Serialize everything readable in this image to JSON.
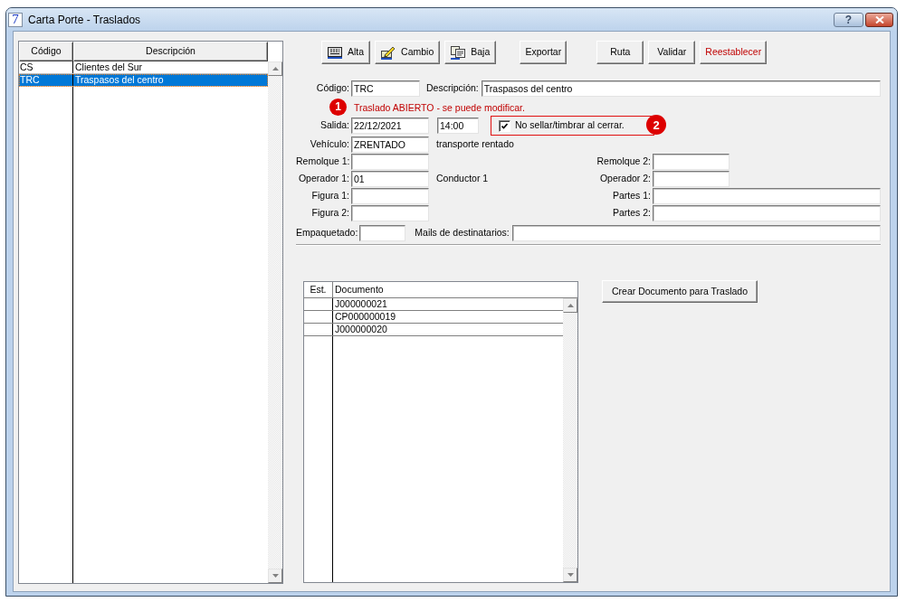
{
  "window": {
    "app_icon": "7",
    "title": "Carta Porte - Traslados",
    "help_button": "?"
  },
  "list": {
    "columns": [
      "Código",
      "Descripción"
    ],
    "rows": [
      {
        "cells": [
          "CS",
          "Clientes del Sur"
        ],
        "selected": false
      },
      {
        "cells": [
          "TRC",
          "Traspasos del centro"
        ],
        "selected": true
      }
    ]
  },
  "toolbar": [
    {
      "buttons": [
        {
          "label": "Alta",
          "kind": "icon"
        },
        {
          "label": "Cambio",
          "kind": "icon"
        },
        {
          "label": "Baja",
          "kind": "icon"
        }
      ]
    },
    {
      "buttons": [
        {
          "label": "Exportar",
          "kind": "text"
        }
      ]
    },
    {
      "buttons": [
        {
          "label": "Ruta",
          "kind": "text"
        },
        {
          "label": "Validar",
          "kind": "text"
        },
        {
          "label": "Reestablecer",
          "kind": "alert"
        }
      ]
    }
  ],
  "header": {
    "code": {
      "label": "Código:",
      "value": "TRC"
    },
    "description": {
      "label": "Descripción:",
      "value": "Traspasos del centro"
    }
  },
  "status": {
    "marker": "1",
    "text": "Traslado ABIERTO - se puede modificar."
  },
  "departure": {
    "label": "Salida:",
    "date": "22/12/2021",
    "time": "14:00",
    "option": {
      "label": "No sellar/timbrar al cerrar.",
      "checked": true,
      "marker": "2"
    }
  },
  "rows": [
    {
      "left": {
        "label": "Vehículo:",
        "value": "ZRENTADO",
        "note": "transporte rentado"
      }
    },
    {
      "left": {
        "label": "Remolque 1:"
      },
      "right": {
        "label": "Remolque 2:",
        "kind": "code"
      }
    },
    {
      "left": {
        "label": "Operador 1:",
        "value": "01",
        "note": "Conductor 1"
      },
      "right": {
        "label": "Operador 2:",
        "kind": "code"
      }
    },
    {
      "left": {
        "label": "Figura 1:"
      },
      "right": {
        "label": "Partes 1:",
        "kind": "text"
      }
    },
    {
      "left": {
        "label": "Figura 2:"
      },
      "right": {
        "label": "Partes 2:",
        "kind": "text"
      }
    }
  ],
  "packing": {
    "label": "Empaquetado:"
  },
  "mails": {
    "label": "Mails de destinatarios:"
  },
  "documents": {
    "columns": [
      "Est.",
      "Documento"
    ],
    "rows": [
      {
        "document": "J000000021"
      },
      {
        "document": "CP000000019"
      },
      {
        "document": "J000000020"
      }
    ]
  },
  "create_button": "Crear Documento para Traslado"
}
